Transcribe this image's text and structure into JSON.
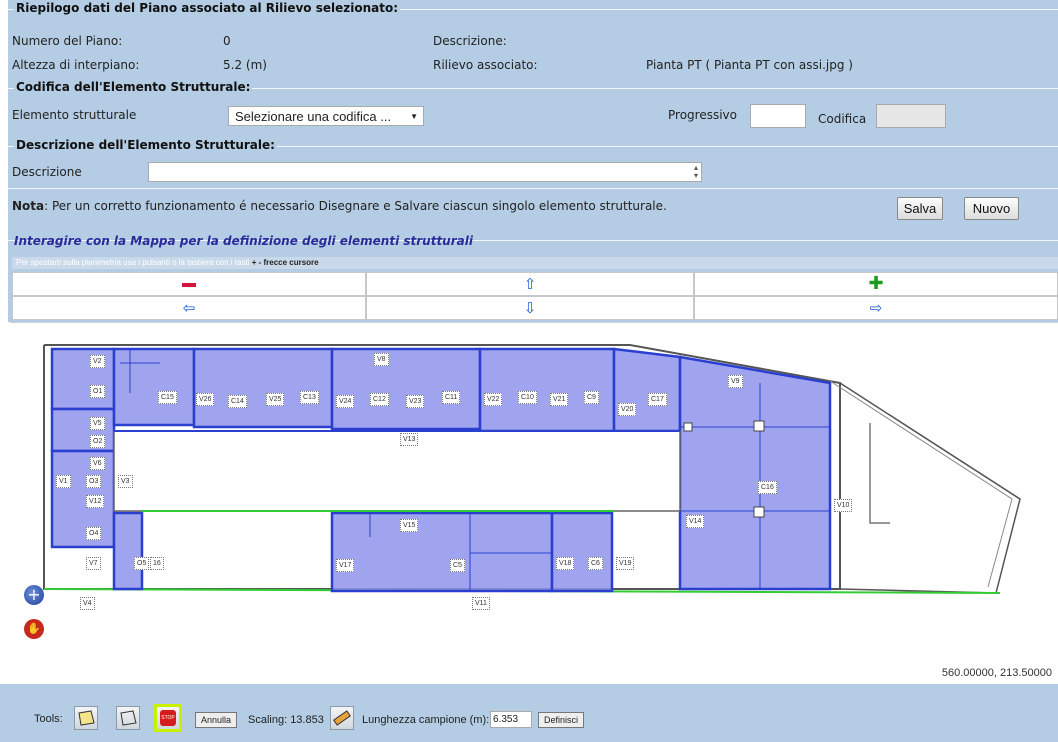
{
  "riepilogo": {
    "legend": "Riepilogo dati del Piano associato al Rilievo selezionato:",
    "numero_label": "Numero del Piano:",
    "numero_value": "0",
    "descrizione_label": "Descrizione:",
    "altezza_label": "Altezza di interpiano:",
    "altezza_value": "5.2 (m)",
    "rilievo_label": "Rilievo associato:",
    "rilievo_value": "Pianta PT ( Pianta PT con assi.jpg )"
  },
  "codifica": {
    "legend": "Codifica dell'Elemento Strutturale:",
    "elemento_label": "Elemento strutturale",
    "select_value": "Selezionare una codifica ...",
    "progressivo_label": "Progressivo",
    "codifica_label": "Codifica"
  },
  "descrizione": {
    "legend": "Descrizione dell'Elemento Strutturale:",
    "label": "Descrizione"
  },
  "nota": {
    "prefix": "Nota",
    "text": ": Per un corretto funzionamento é necessario Disegnare e Salvare ciascun singolo elemento strutturale.",
    "salva": "Salva",
    "nuovo": "Nuovo"
  },
  "map": {
    "title": "Interagire con la Mappa per la definizione degli elementi strutturali",
    "hint": "Per spostarti sulla planimetria usa i pulsanti o la tastiera con i tasti",
    "hint_bold": "+ - frecce cursore",
    "coords": "560.00000, 213.50000",
    "labels": [
      "V2",
      "O1",
      "V5",
      "O2",
      "V6",
      "V1",
      "O3",
      "V3",
      "V12",
      "O4",
      "V7",
      "O5",
      "16",
      "V4",
      "C15",
      "V26",
      "C14",
      "V25",
      "C13",
      "V24",
      "V8",
      "C12",
      "V23",
      "C11",
      "V22",
      "C10",
      "V21",
      "C9",
      "V20",
      "C17",
      "V9",
      "V13",
      "C16",
      "V14",
      "V10",
      "V15",
      "V17",
      "C5",
      "V18",
      "C6",
      "V19",
      "V11"
    ]
  },
  "toolbar": {
    "tools_label": "Tools:",
    "annulla": "Annulla",
    "scaling": "Scaling: 13.853",
    "lunghezza_label": "Lunghezza campione (m):",
    "lunghezza_value": "6.353",
    "definisci": "Definisci"
  },
  "colors": {
    "panel": "#b4cde4",
    "room_fill": "#8f94ec",
    "room_border": "#2a3fd0",
    "active_tool": "#c8f000"
  }
}
